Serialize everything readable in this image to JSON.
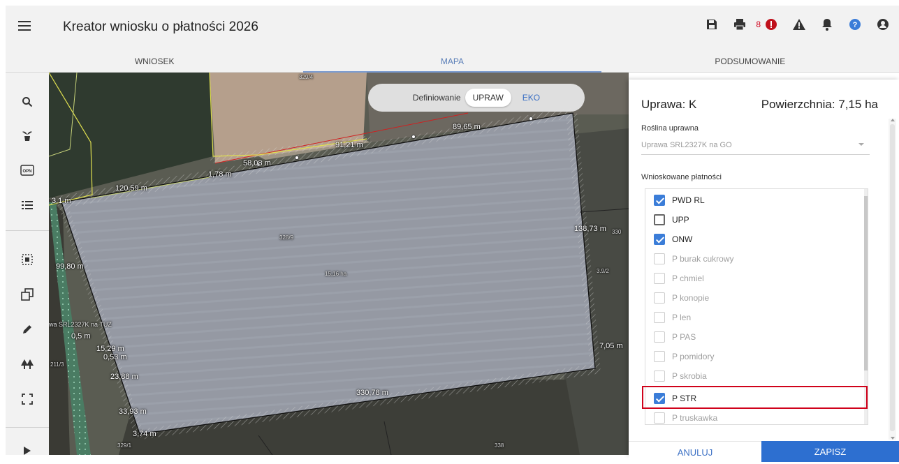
{
  "app": {
    "title": "Kreator wniosku o płatności 2026",
    "warning_count": "8"
  },
  "tabs": [
    {
      "label": "WNIOSEK",
      "active": false
    },
    {
      "label": "MAPA",
      "active": true
    },
    {
      "label": "PODSUMOWANIE",
      "active": false
    }
  ],
  "map": {
    "definition": {
      "label": "Definiowanie",
      "upraw": "UPRAW",
      "eko": "EKO"
    },
    "dimension_labels": [
      "91,21 m",
      "89,65 m",
      "58,08 m",
      "1,78 m",
      "120,59 m",
      "138,73 m",
      "99,80 m",
      "15,29 m",
      "23,88 m",
      "33,93 m",
      "3,74 m",
      "330,78 m",
      "7,05 m",
      "0,5 m",
      "0,53 m",
      "3,1 m"
    ],
    "parcel_labels": [
      "328/9",
      "330",
      "329/4",
      "3.9/2",
      "329/1",
      "211/3",
      "338",
      "15,16 ha"
    ],
    "crop_label": "wa SRL2327K na TUZ"
  },
  "panel": {
    "crop_title": "Uprawa: K",
    "area": "Powierzchnia: 7,15 ha",
    "crop_field_label": "Roślina uprawna",
    "crop_field_value": "Uprawa SRL2327K na GO",
    "payments_label": "Wnioskowane płatności",
    "payments": [
      {
        "label": "PWD RL",
        "checked": true,
        "enabled": true
      },
      {
        "label": "UPP",
        "checked": false,
        "enabled": true
      },
      {
        "label": "ONW",
        "checked": true,
        "enabled": true
      },
      {
        "label": "P burak cukrowy",
        "checked": false,
        "enabled": false
      },
      {
        "label": "P chmiel",
        "checked": false,
        "enabled": false
      },
      {
        "label": "P konopie",
        "checked": false,
        "enabled": false
      },
      {
        "label": "P len",
        "checked": false,
        "enabled": false
      },
      {
        "label": "P PAS",
        "checked": false,
        "enabled": false
      },
      {
        "label": "P pomidory",
        "checked": false,
        "enabled": false
      },
      {
        "label": "P skrobia",
        "checked": false,
        "enabled": false
      },
      {
        "label": "P STR",
        "checked": true,
        "enabled": true
      },
      {
        "label": "P truskawka",
        "checked": false,
        "enabled": false
      }
    ],
    "cancel_label": "ANULUJ",
    "save_label": "ZAPISZ"
  },
  "colors": {
    "accent": "#2d6fd0",
    "highlight": "#d0021b",
    "warning": "#d0021b",
    "help": "#3b7dd8"
  }
}
